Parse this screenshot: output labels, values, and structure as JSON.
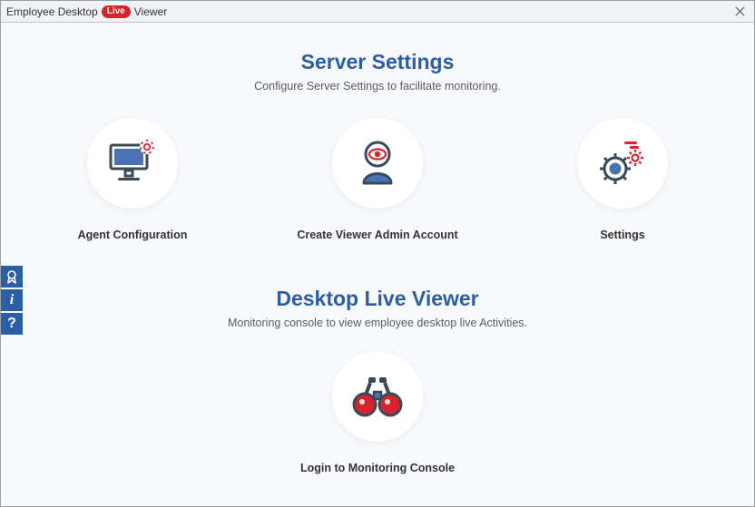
{
  "titlebar": {
    "prefix": "Employee Desktop",
    "badge": "Live",
    "suffix": "Viewer"
  },
  "sections": {
    "server": {
      "title": "Server Settings",
      "subtitle": "Configure Server Settings to facilitate monitoring.",
      "tiles": [
        {
          "label": "Agent Configuration"
        },
        {
          "label": "Create Viewer Admin Account"
        },
        {
          "label": "Settings"
        }
      ]
    },
    "viewer": {
      "title": "Desktop Live Viewer",
      "subtitle": "Monitoring console to view employee desktop live Activities.",
      "tiles": [
        {
          "label": "Login to Monitoring Console"
        }
      ]
    }
  },
  "ribbon": {
    "info": "i",
    "help": "?"
  }
}
